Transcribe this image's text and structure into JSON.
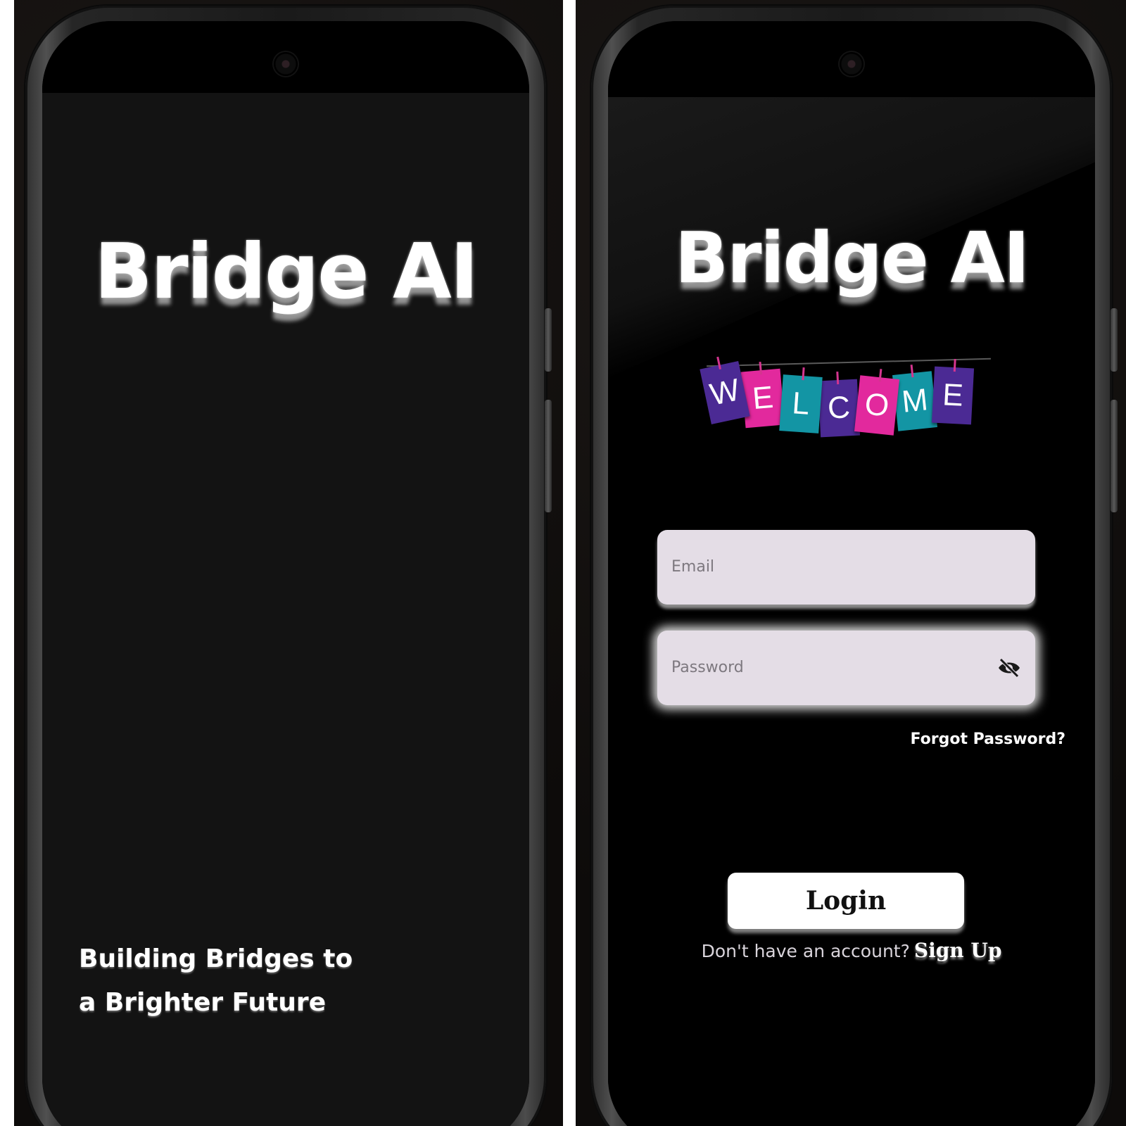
{
  "splash_screen": {
    "brand_title": "Bridge AI",
    "tagline_line1": "Building Bridges to",
    "tagline_line2": "a Brighter Future"
  },
  "login_screen": {
    "brand_title": "Bridge AI",
    "welcome_banner": {
      "letters": [
        "W",
        "E",
        "L",
        "C",
        "O",
        "M",
        "E"
      ],
      "colors": [
        "#4b2a94",
        "#e2299d",
        "#1395a4",
        "#4b2a94",
        "#e2299d",
        "#1395a4",
        "#4b2a94"
      ]
    },
    "email_placeholder": "Email",
    "password_placeholder": "Password",
    "password_toggle_icon": "eye-off-icon",
    "forgot_password_label": "Forgot Password?",
    "login_button_label": "Login",
    "signup_prompt": "Don't have an account?",
    "signup_link_label": "Sign Up"
  },
  "colors": {
    "splash_background": "#131313",
    "login_background": "#000000",
    "input_fill": "#e4dde6",
    "button_fill": "#ffffff"
  }
}
